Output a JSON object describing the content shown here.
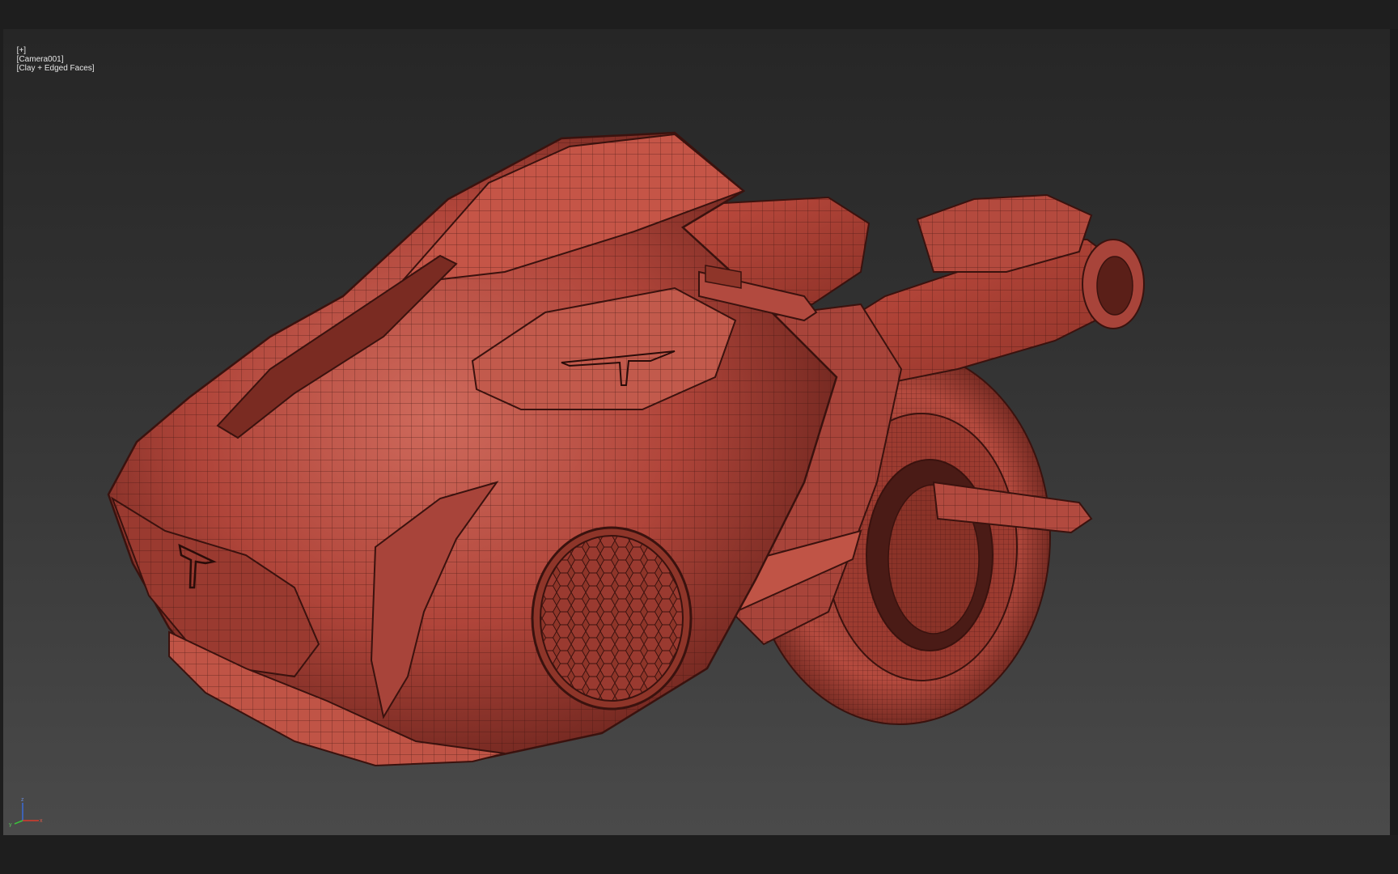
{
  "viewport": {
    "label_parts": [
      "[+]",
      "[Camera001]",
      "[Clay + Edged Faces]"
    ],
    "axis": {
      "x": "x",
      "y": "y",
      "z": "z"
    },
    "colors": {
      "background_top": "#262626",
      "background_bottom": "#4a4a4a",
      "clay": "#b9463a",
      "clay_dark": "#7a2a22",
      "edges": "#3a120e",
      "axis_x": "#d83a2a",
      "axis_y": "#3ac23a",
      "axis_z": "#3a6ad8"
    }
  }
}
